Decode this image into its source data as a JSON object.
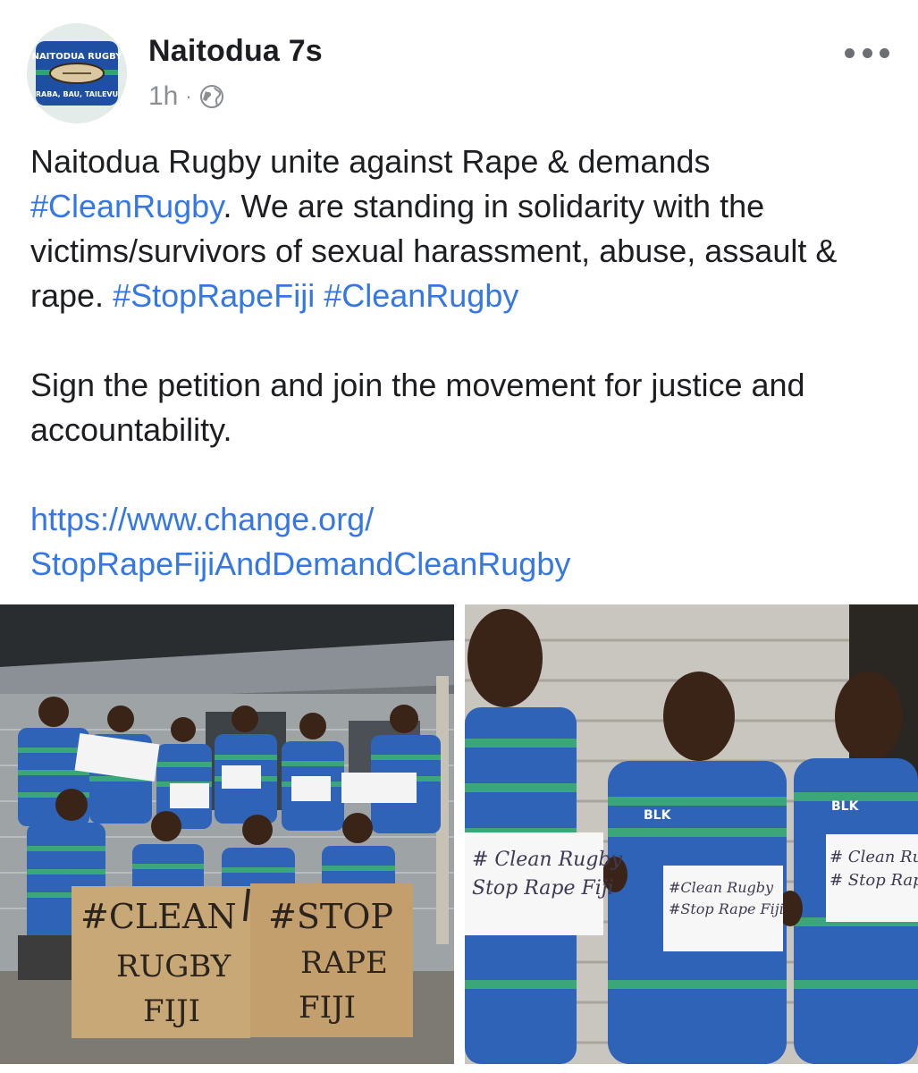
{
  "post": {
    "author": "Naitodua 7s",
    "time": "1h",
    "separator": "·",
    "privacy_icon": "globe-icon",
    "more_icon": "more-dots-icon",
    "avatar": {
      "logo_top": "NAITODUA RUGBY",
      "logo_bottom": "RABA, BAU, TAILEVU"
    },
    "body": {
      "line1": "Naitodua Rugby unite against Rape & demands",
      "tag_clean": "#CleanRugby",
      "line2_rest": ". We are standing in solidarity with the victims/survivors of sexual harassment, abuse, assault & rape. ",
      "tag_stop": "#StopRapeFiji",
      "tag_clean2": "#CleanRugby",
      "para2": "Sign the petition and join the movement for justice and accountability.",
      "link_line1": "https://www.change.org/",
      "link_line2": "StopRapeFijiAndDemandCleanRugby"
    }
  },
  "photos": {
    "left": {
      "sign_left_1": "#CLEAN",
      "sign_left_2": "RUGBY",
      "sign_left_3": "FIJI",
      "sign_right_1": "#STOP",
      "sign_right_2": "RAPE",
      "sign_right_3": "FIJI"
    },
    "right": {
      "card1_line1": "# Clean Rugby",
      "card1_line2": "Stop Rape Fiji",
      "card2_line1": "#Clean Rugby",
      "card2_line2": "#Stop Rape Fiji",
      "card3_line1": "# Clean Rugb",
      "card3_line2": "# Stop Rape",
      "jersey_brand": "BLK"
    }
  },
  "colors": {
    "link": "#3578e5",
    "text": "#1c1e21",
    "meta": "#8a8d91",
    "jersey_blue": "#2f63b8",
    "jersey_green": "#3aa67a"
  }
}
